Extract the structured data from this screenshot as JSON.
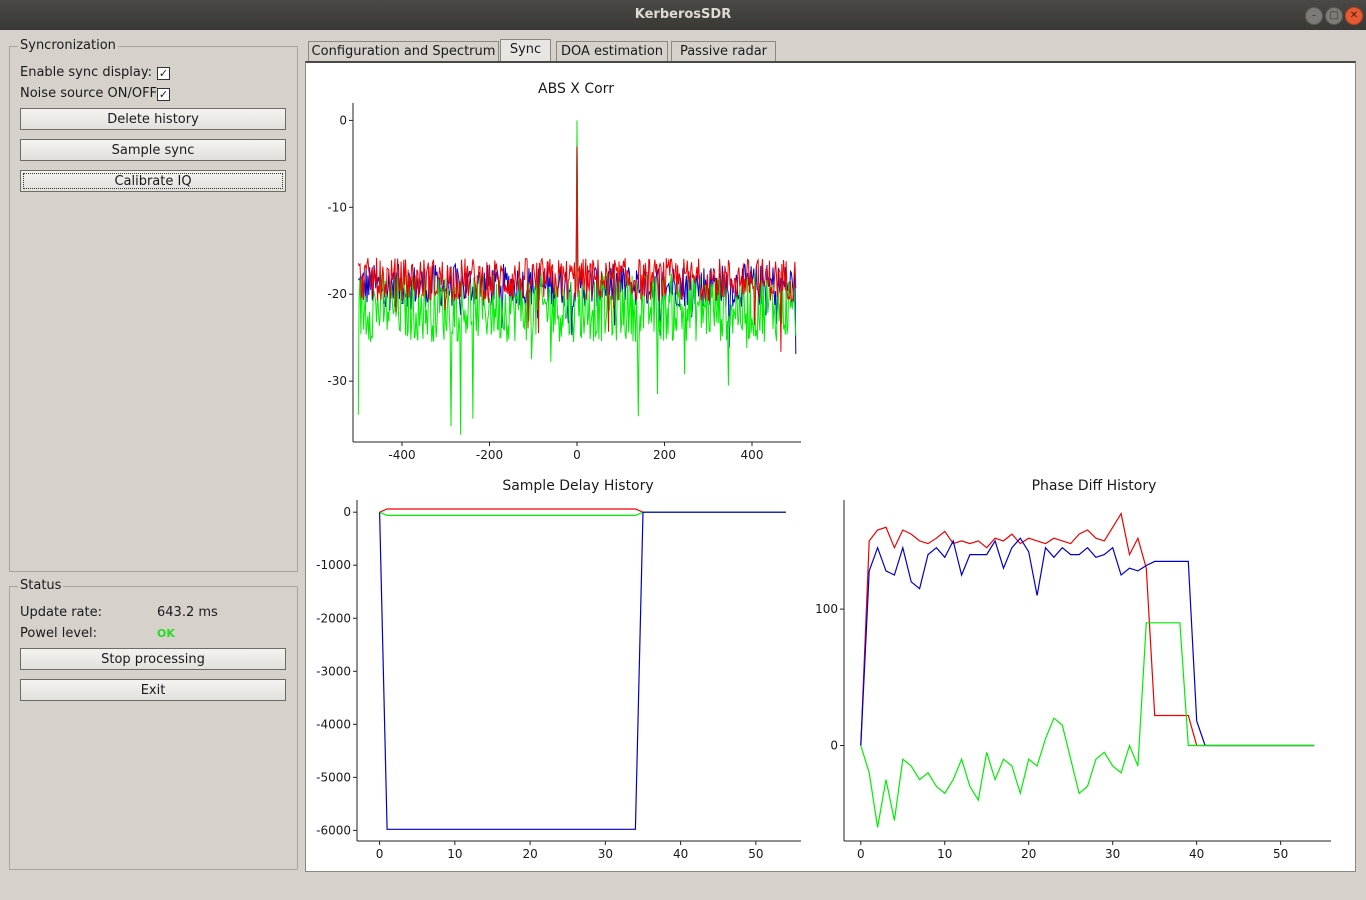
{
  "window": {
    "title": "KerberosSDR"
  },
  "sync_group": {
    "title": "Syncronization",
    "enable_sync_label": "Enable sync display:",
    "enable_sync_checked": true,
    "noise_source_label": "Noise source ON/OFF",
    "noise_source_checked": true,
    "delete_history": "Delete history",
    "sample_sync": "Sample sync",
    "calibrate_iq": "Calibrate IQ"
  },
  "status_group": {
    "title": "Status",
    "update_rate_label": "Update rate:",
    "update_rate_value": "643.2 ms",
    "power_level_label": "Powel level:",
    "power_level_value": "OK",
    "power_level_color": "#22dd22",
    "stop_processing": "Stop processing",
    "exit": "Exit"
  },
  "tabs": [
    {
      "label": "Configuration and Spectrum",
      "active": false
    },
    {
      "label": "Sync",
      "active": true
    },
    {
      "label": "DOA estimation",
      "active": false
    },
    {
      "label": "Passive radar",
      "active": false
    }
  ],
  "colors": {
    "series1": "#0000cc",
    "series2": "#ee0000",
    "series3": "#00ee00"
  },
  "chart_data": [
    {
      "type": "line",
      "title": "ABS X Corr",
      "xlim": [
        -512,
        512
      ],
      "ylim": [
        -37,
        2
      ],
      "xticks": [
        -400,
        -200,
        0,
        200,
        400
      ],
      "yticks": [
        0,
        -10,
        -20,
        -30
      ],
      "noise_floor": {
        "blue": -19,
        "red": -18.3,
        "green": -21.5
      },
      "peak": {
        "x": 0,
        "blue": -2.5,
        "red": -3,
        "green": 0
      },
      "series_colors": [
        "#0000cc",
        "#ee0000",
        "#00ee00"
      ]
    },
    {
      "type": "line",
      "title": "Sample Delay History",
      "xlim": [
        -3,
        56
      ],
      "ylim": [
        -6200,
        230
      ],
      "xticks": [
        0,
        10,
        20,
        30,
        40,
        50
      ],
      "yticks": [
        0,
        -1000,
        -2000,
        -3000,
        -4000,
        -5000,
        -6000
      ],
      "x": [
        0,
        1,
        34,
        35,
        54
      ],
      "series": [
        {
          "color": "#ee0000",
          "values": [
            0,
            60,
            60,
            0,
            0
          ]
        },
        {
          "color": "#00ee00",
          "values": [
            0,
            -60,
            -60,
            0,
            0
          ]
        },
        {
          "color": "#0000cc",
          "values": [
            0,
            -5980,
            -5980,
            0,
            0
          ]
        }
      ]
    },
    {
      "type": "line",
      "title": "Phase Diff History",
      "xlim": [
        -2,
        56
      ],
      "ylim": [
        -70,
        180
      ],
      "xticks": [
        0,
        10,
        20,
        30,
        40,
        50
      ],
      "yticks": [
        100,
        0
      ],
      "x": [
        0,
        1,
        2,
        3,
        4,
        5,
        6,
        7,
        8,
        9,
        10,
        11,
        12,
        13,
        14,
        15,
        16,
        17,
        18,
        19,
        20,
        21,
        22,
        23,
        24,
        25,
        26,
        27,
        28,
        29,
        30,
        31,
        32,
        33,
        34,
        35,
        36,
        37,
        38,
        39,
        40,
        41,
        42,
        43,
        44,
        45,
        46,
        47,
        48,
        49,
        50,
        51,
        52,
        53,
        54
      ],
      "series": [
        {
          "color": "#ee0000",
          "values": [
            0,
            150,
            158,
            160,
            145,
            158,
            155,
            150,
            148,
            152,
            157,
            148,
            150,
            148,
            150,
            145,
            152,
            150,
            155,
            148,
            152,
            150,
            148,
            152,
            150,
            148,
            155,
            158,
            152,
            150,
            160,
            170,
            140,
            152,
            130,
            22,
            22,
            22,
            22,
            22,
            0,
            0,
            0,
            0,
            0,
            0,
            0,
            0,
            0,
            0,
            0,
            0,
            0,
            0,
            0
          ]
        },
        {
          "color": "#0000cc",
          "values": [
            0,
            128,
            145,
            128,
            125,
            145,
            120,
            115,
            140,
            145,
            138,
            150,
            125,
            140,
            140,
            140,
            150,
            130,
            145,
            152,
            142,
            110,
            145,
            138,
            145,
            140,
            140,
            145,
            138,
            140,
            145,
            125,
            130,
            128,
            132,
            135,
            135,
            135,
            135,
            135,
            18,
            0,
            0,
            0,
            0,
            0,
            0,
            0,
            0,
            0,
            0,
            0,
            0,
            0,
            0
          ]
        },
        {
          "color": "#00ee00",
          "values": [
            0,
            -20,
            -60,
            -25,
            -55,
            -10,
            -15,
            -25,
            -20,
            -30,
            -35,
            -25,
            -10,
            -30,
            -40,
            -5,
            -25,
            -10,
            -15,
            -35,
            -10,
            -15,
            5,
            20,
            15,
            -10,
            -35,
            -30,
            -10,
            -5,
            -15,
            -20,
            0,
            -15,
            90,
            90,
            90,
            90,
            90,
            0,
            0,
            0,
            0,
            0,
            0,
            0,
            0,
            0,
            0,
            0,
            0,
            0,
            0,
            0,
            0
          ]
        }
      ]
    }
  ]
}
